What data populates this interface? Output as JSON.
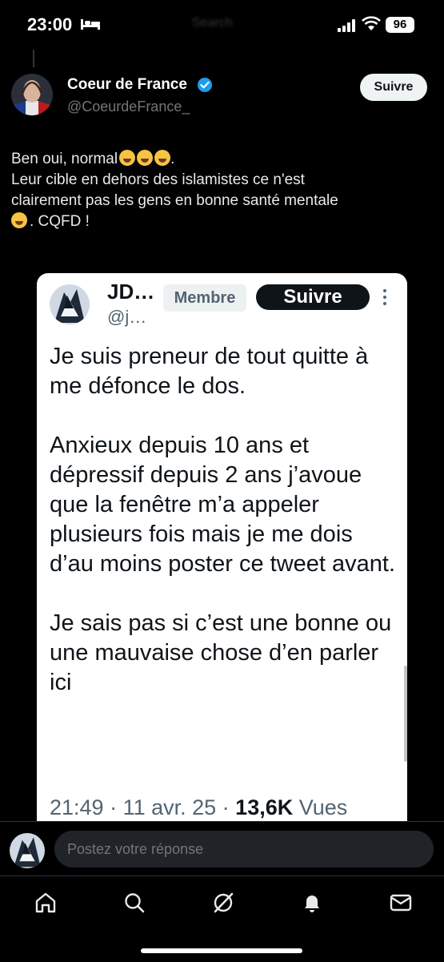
{
  "status_bar": {
    "time": "23:00",
    "battery": "96",
    "center_text": "Search"
  },
  "author": {
    "name": "Coeur de France",
    "handle": "@CoeurdeFrance_",
    "follow_label": "Suivre",
    "verified": true
  },
  "tweet": {
    "lines": [
      "Ben oui, normal",
      "Leur cible en dehors des islamistes ce n'est",
      "clairement pas les gens en bonne santé mentale",
      ". CQFD !"
    ]
  },
  "quoted": {
    "name": "JD…",
    "handle": "@j…",
    "badge": "Membre",
    "follow_label": "Suivre",
    "paragraphs": [
      "Je suis preneur de tout quitte à me défonce le dos.",
      "Anxieux depuis 10 ans et dépressif depuis 2 ans j’avoue que la fenêtre m’a appeler plusieurs fois mais je me dois d’au moins poster ce tweet avant.",
      "Je sais pas si c’est une bonne ou une mauvaise chose d’en parler ici"
    ],
    "time": "21:49",
    "date": "11 avr. 25",
    "views_count": "13,6K",
    "views_label": "Vues"
  },
  "reply": {
    "placeholder": "Postez votre réponse"
  },
  "nav": {
    "items": [
      "home-icon",
      "search-icon",
      "grok-icon",
      "notifications-icon",
      "messages-icon"
    ]
  },
  "colors": {
    "background": "#000000",
    "text": "#e7e9ea",
    "muted": "#71767b",
    "verified": "#1d9bf0"
  }
}
